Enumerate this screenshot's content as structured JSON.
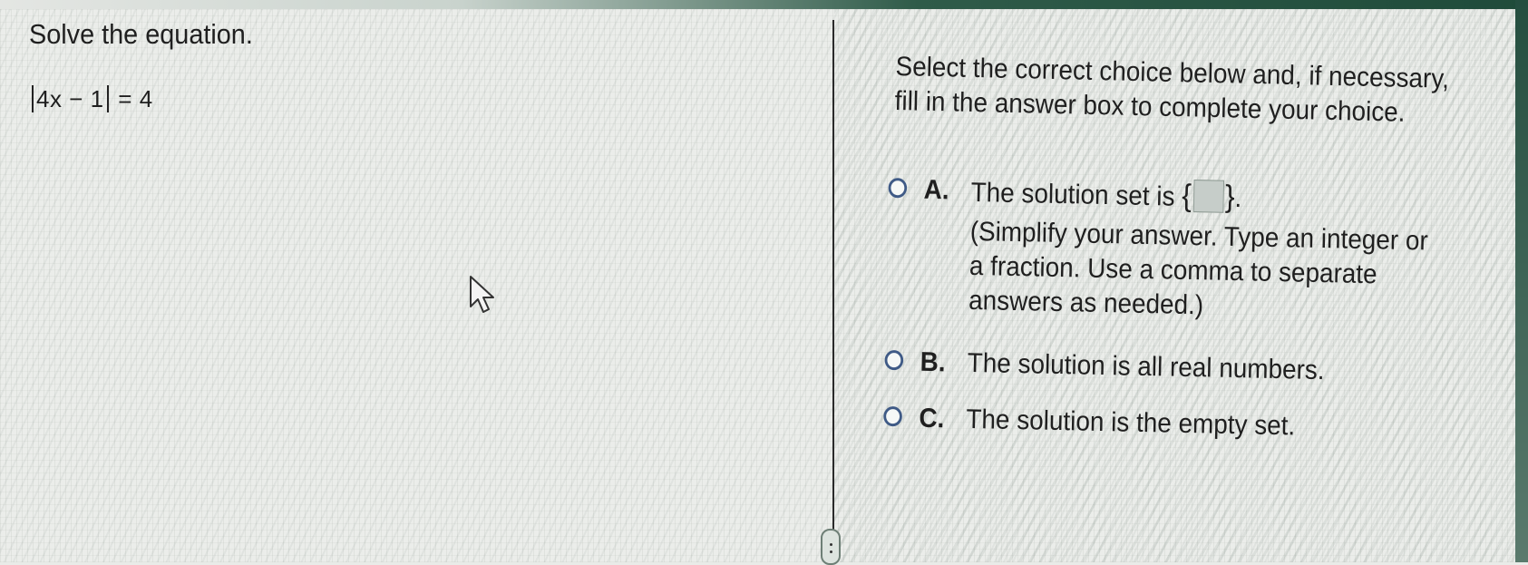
{
  "question": {
    "title": "Solve the equation.",
    "equation": {
      "abs_inner": "4x − 1",
      "rhs": "= 4"
    }
  },
  "instructions": {
    "line1": "Select the correct choice below and, if necessary,",
    "line2": "fill in the answer box to complete your choice."
  },
  "choices": [
    {
      "letter": "A.",
      "text": "The solution set is",
      "brace_open": "{",
      "brace_close": "}",
      "answer_value": "",
      "hint_lines": [
        "(Simplify your answer. Type an integer or",
        "a fraction. Use a comma to separate",
        "answers as needed.)"
      ],
      "selected": false
    },
    {
      "letter": "B.",
      "text": "The solution is all real numbers.",
      "selected": false
    },
    {
      "letter": "C.",
      "text": "The solution is the empty set.",
      "selected": false
    }
  ],
  "colors": {
    "radio_border": "#3f5a86",
    "top_strip": "#1f4b3a",
    "answer_box": "#c6cdc9"
  },
  "icons": {
    "cursor": "mouse-pointer-icon",
    "radio": "radio-unselected-icon",
    "divider_handle": "resize-handle-icon"
  }
}
